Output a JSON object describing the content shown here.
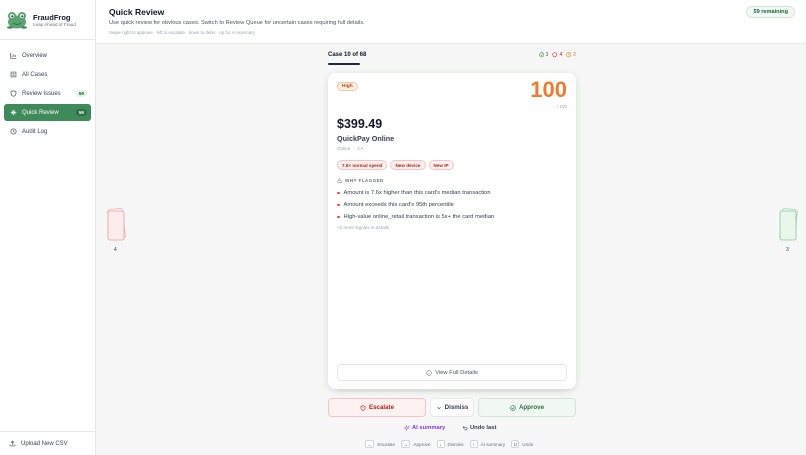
{
  "brand": {
    "name": "FraudFrog",
    "tagline": "Leap Ahead of Fraud"
  },
  "sidebar": {
    "items": [
      {
        "label": "Overview",
        "icon": "chart-icon",
        "badge": null,
        "active": false
      },
      {
        "label": "All Cases",
        "icon": "list-icon",
        "badge": null,
        "active": false
      },
      {
        "label": "Review Issues",
        "icon": "shield-icon",
        "badge": "59",
        "active": false
      },
      {
        "label": "Quick Review",
        "icon": "bolt-icon",
        "badge": "59",
        "active": true
      },
      {
        "label": "Audit Log",
        "icon": "history-icon",
        "badge": null,
        "active": false
      }
    ],
    "upload_label": "Upload New CSV"
  },
  "header": {
    "title": "Quick Review",
    "subtitle": "Use quick review for obvious cases. Switch to Review Queue for uncertain cases requiring full details.",
    "hint": "Swipe right to approve · left to escalate · down to defer · up for AI summary",
    "remaining": "59 remaining"
  },
  "progress": {
    "case_label": "Case 10 of 68",
    "stats": {
      "approved": "3",
      "escalated": "4",
      "deferred": "2"
    }
  },
  "card": {
    "risk_level": "High",
    "score": "100",
    "score_max": "/ 100",
    "amount": "$399.49",
    "merchant": "QuickPay Online",
    "channel": "Online",
    "region": "CA",
    "tags": [
      "7.6× normal spend",
      "New device",
      "New IP"
    ],
    "why_flagged_label": "WHY FLAGGED",
    "reasons": [
      "Amount is 7.6x higher than this card's median transaction",
      "Amount exceeds this card's 95th percentile",
      "High-value online_retail transaction is 5x+ the card median"
    ],
    "more_signals": "+2 more signals in details",
    "view_details_label": "View Full Details"
  },
  "side_stacks": {
    "escalated_count": "4",
    "approved_count": "3"
  },
  "actions": {
    "escalate": "Escalate",
    "dismiss": "Dismiss",
    "approve": "Approve",
    "ai_summary": "AI summary",
    "undo_last": "Undo last"
  },
  "shortcuts": [
    {
      "key": "←",
      "label": "Escalate"
    },
    {
      "key": "→",
      "label": "Approve"
    },
    {
      "key": "↓",
      "label": "Dismiss"
    },
    {
      "key": "↑",
      "label": "AI summary"
    },
    {
      "key": "U",
      "label": "Undo"
    }
  ],
  "colors": {
    "accent": "#3f8a5a",
    "score": "#f07b2c",
    "danger": "#b42318",
    "ai": "#7c3aed"
  }
}
